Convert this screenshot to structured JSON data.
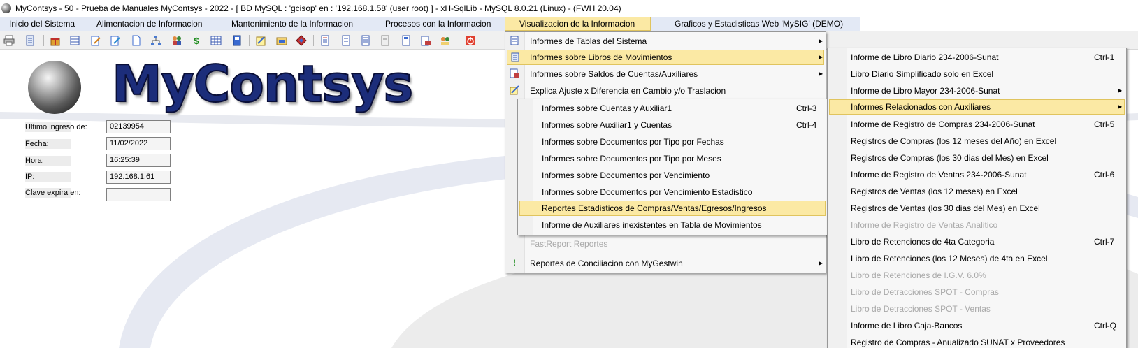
{
  "window": {
    "title": "MyContsys - 50 - Prueba de Manuales MyContsys - 2022 - [ BD MySQL : 'gcisop' en : '192.168.1.58' (user root) ] - xH-SqlLib - MySQL 8.0.21 (Linux) - (FWH 20.04)"
  },
  "menubar": [
    {
      "label": "Inicio del Sistema"
    },
    {
      "label": "Alimentacion de Informacion"
    },
    {
      "label": "Mantenimiento de la Informacion"
    },
    {
      "label": "Procesos con la Informacion"
    },
    {
      "label": "Visualizacion de la Informacion"
    },
    {
      "label": "Graficos y Estadisticas Web 'MySIG' (DEMO)"
    }
  ],
  "toolbar_icons": [
    "printer-icon",
    "report-icon",
    "gift-icon",
    "table-icon",
    "edit-document-icon",
    "edit-document-alt-icon",
    "blank-document-icon",
    "org-chart-icon",
    "users-icon",
    "dollar-icon",
    "grid-icon",
    "book-icon",
    "notepad-icon",
    "folder-edit-icon",
    "diamond-tool-icon",
    "ledger-icon",
    "page-icon",
    "page-lines-icon",
    "page-grey-icon",
    "list-doc-icon",
    "folder-report-icon",
    "people-report-icon",
    "power-icon"
  ],
  "logo": {
    "text": "MyContsys"
  },
  "login_info": {
    "fields": [
      {
        "label": "Ultimo ingreso de:",
        "value": "02139954"
      },
      {
        "label": "Fecha:",
        "value": "11/02/2022"
      },
      {
        "label": "Hora:",
        "value": "16:25:39"
      },
      {
        "label": "IP:",
        "value": "192.168.1.61"
      },
      {
        "label": "Clave expira en:",
        "value": ""
      }
    ]
  },
  "menu_visualizacion": [
    {
      "label": "Informes de Tablas del Sistema",
      "submenu": true,
      "icon": "document-icon",
      "enabled": true
    },
    {
      "label": "Informes sobre Libros de Movimientos",
      "submenu": true,
      "icon": "book-list-icon",
      "enabled": true,
      "highlighted": true
    },
    {
      "label": "Informes sobre Saldos de Cuentas/Auxiliares",
      "submenu": true,
      "icon": "ledger-icon",
      "enabled": true
    },
    {
      "label": "Explica Ajuste x Diferencia en Cambio y/o Traslacion",
      "submenu": false,
      "icon": "pencil-icon",
      "enabled": true
    },
    {
      "label": "FastReport Reportes",
      "submenu": false,
      "icon": "",
      "enabled": false
    },
    {
      "label": "Reportes de Conciliacion con MyGestwin",
      "submenu": true,
      "icon": "exclamation-icon",
      "enabled": true
    }
  ],
  "submenu_cuentas": [
    {
      "label": "Informes sobre Cuentas y Auxiliar1",
      "shortcut": "Ctrl-3"
    },
    {
      "label": "Informes sobre Auxiliar1 y Cuentas",
      "shortcut": "Ctrl-4"
    },
    {
      "label": "Informes sobre Documentos por Tipo por Fechas",
      "shortcut": ""
    },
    {
      "label": "Informes sobre Documentos por Tipo por Meses",
      "shortcut": ""
    },
    {
      "label": "Informes sobre Documentos por Vencimiento",
      "shortcut": ""
    },
    {
      "label": "Informes sobre Documentos por Vencimiento Estadistico",
      "shortcut": ""
    },
    {
      "label": "Reportes Estadisticos de Compras/Ventas/Egresos/Ingresos",
      "shortcut": "",
      "highlighted": true
    },
    {
      "label": "Informe de Auxiliares inexistentes en Tabla de Movimientos",
      "shortcut": ""
    }
  ],
  "submenu_libros": [
    {
      "label": "Informe de Libro Diario 234-2006-Sunat",
      "shortcut": "Ctrl-1",
      "submenu": false,
      "enabled": true
    },
    {
      "label": "Libro Diario Simplificado solo en Excel",
      "shortcut": "",
      "submenu": false,
      "enabled": true
    },
    {
      "label": "Informe de Libro Mayor 234-2006-Sunat",
      "shortcut": "",
      "submenu": true,
      "enabled": true
    },
    {
      "label": "Informes Relacionados con Auxiliares",
      "shortcut": "",
      "submenu": true,
      "enabled": true,
      "highlighted": true
    },
    {
      "label": "Informe de Registro de Compras 234-2006-Sunat",
      "shortcut": "Ctrl-5",
      "submenu": false,
      "enabled": true
    },
    {
      "label": "Registros de Compras (los 12 meses del Año) en Excel",
      "shortcut": "",
      "submenu": false,
      "enabled": true
    },
    {
      "label": "Registros de Compras (los 30 dias del Mes) en Excel",
      "shortcut": "",
      "submenu": false,
      "enabled": true
    },
    {
      "label": "Informe de Registro de Ventas 234-2006-Sunat",
      "shortcut": "Ctrl-6",
      "submenu": false,
      "enabled": true
    },
    {
      "label": "Registros de Ventas (los 12 meses) en Excel",
      "shortcut": "",
      "submenu": false,
      "enabled": true
    },
    {
      "label": "Registros de Ventas (los 30 dias del Mes) en Excel",
      "shortcut": "",
      "submenu": false,
      "enabled": true
    },
    {
      "label": "Informe de Registro de Ventas Analitico",
      "shortcut": "",
      "submenu": false,
      "enabled": false
    },
    {
      "label": "Libro de Retenciones de 4ta Categoria",
      "shortcut": "Ctrl-7",
      "submenu": false,
      "enabled": true
    },
    {
      "label": "Libro de Retenciones (los 12 Meses) de 4ta en Excel",
      "shortcut": "",
      "submenu": false,
      "enabled": true
    },
    {
      "label": "Libro de Retenciones de I.G.V. 6.0%",
      "shortcut": "",
      "submenu": false,
      "enabled": false
    },
    {
      "label": "Libro de Detracciones SPOT - Compras",
      "shortcut": "",
      "submenu": false,
      "enabled": false
    },
    {
      "label": "Libro de Detracciones SPOT - Ventas",
      "shortcut": "",
      "submenu": false,
      "enabled": false
    },
    {
      "label": "Informe de Libro Caja-Bancos",
      "shortcut": "Ctrl-Q",
      "submenu": false,
      "enabled": true
    },
    {
      "label": "Registro de Compras - Anualizado SUNAT x Proveedores",
      "shortcut": "",
      "submenu": false,
      "enabled": true
    }
  ],
  "colors": {
    "highlight": "#fbe9a4",
    "menubar": "#e3e9f5",
    "logo": "#1c2d7a",
    "disabled": "#a9a9a9"
  }
}
